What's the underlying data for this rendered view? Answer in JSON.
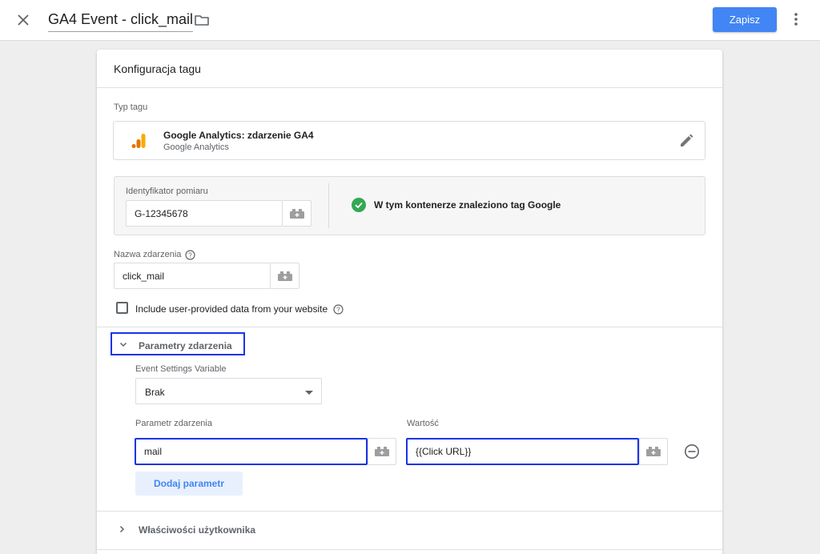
{
  "header": {
    "title": "GA4 Event - click_mail",
    "save_label": "Zapisz"
  },
  "card": {
    "title": "Konfiguracja tagu",
    "tag_type": {
      "label": "Typ tagu",
      "name": "Google Analytics: zdarzenie GA4",
      "vendor": "Google Analytics"
    },
    "measurement": {
      "label": "Identyfikator pomiaru",
      "value": "G-12345678",
      "status_text": "W tym kontenerze znaleziono tag Google"
    },
    "event_name": {
      "label": "Nazwa zdarzenia",
      "value": "click_mail"
    },
    "user_data": {
      "label": "Include user-provided data from your website",
      "checked": false
    },
    "event_params": {
      "title": "Parametry zdarzenia",
      "settings_variable_label": "Event Settings Variable",
      "settings_variable_value": "Brak",
      "param_col_label": "Parametr zdarzenia",
      "value_col_label": "Wartość",
      "rows": [
        {
          "param": "mail",
          "value": "{{Click URL}}"
        }
      ],
      "add_button": "Dodaj parametr"
    },
    "user_props": {
      "title": "Właściwości użytkownika"
    }
  },
  "colors": {
    "accent": "#4285f4",
    "highlight": "#1a33e8",
    "success": "#34a853",
    "ga_orange": "#f9ab00",
    "ga_dark_orange": "#e37400"
  }
}
